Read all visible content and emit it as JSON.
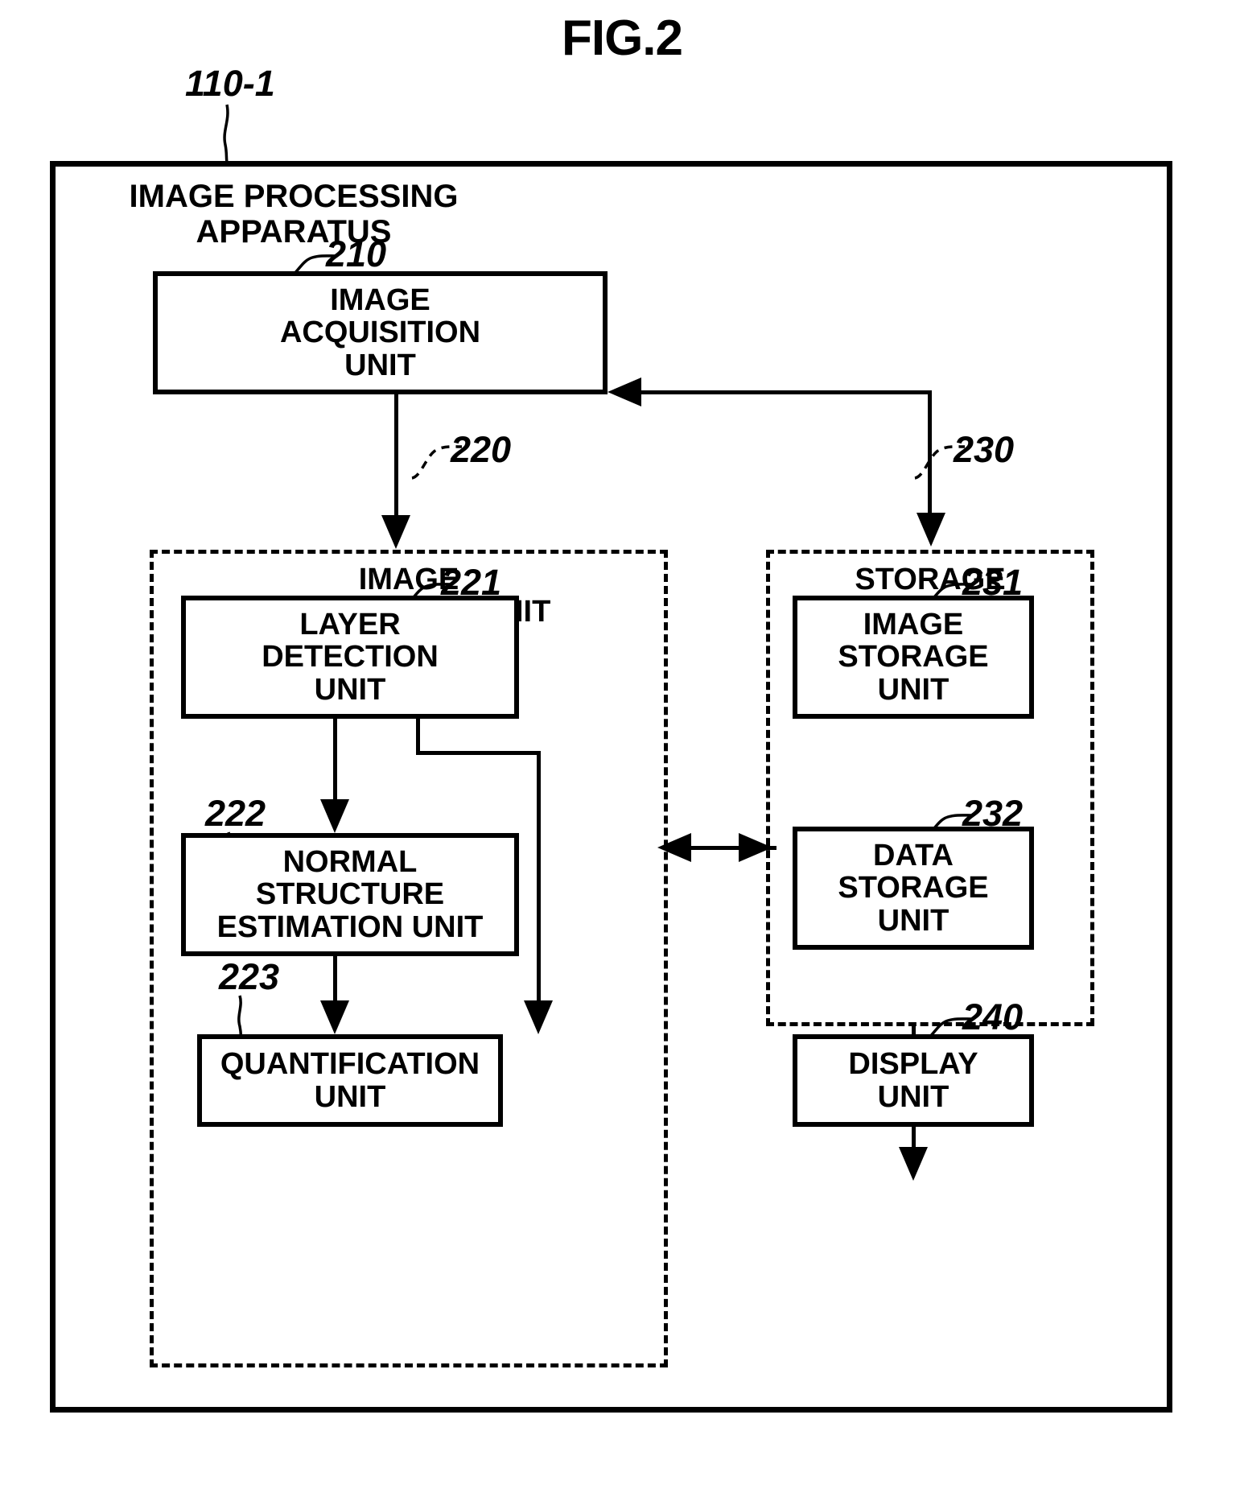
{
  "figure": {
    "title": "FIG.2",
    "apparatus_ref": "110-1",
    "apparatus_title": "IMAGE PROCESSING\nAPPARATUS"
  },
  "blocks": {
    "image_acquisition": {
      "ref": "210",
      "label": "IMAGE\nACQUISITION\nUNIT"
    },
    "image_processing": {
      "ref": "220",
      "label": "IMAGE\nPROCESSING UNIT"
    },
    "layer_detection": {
      "ref": "221",
      "label": "LAYER\nDETECTION\nUNIT"
    },
    "normal_structure": {
      "ref": "222",
      "label": "NORMAL\nSTRUCTURE\nESTIMATION UNIT"
    },
    "quantification": {
      "ref": "223",
      "label": "QUANTIFICATION\nUNIT"
    },
    "storage": {
      "ref": "230",
      "label": "STORAGE\nUNIT"
    },
    "image_storage": {
      "ref": "231",
      "label": "IMAGE\nSTORAGE\nUNIT"
    },
    "data_storage": {
      "ref": "232",
      "label": "DATA\nSTORAGE\nUNIT"
    },
    "display": {
      "ref": "240",
      "label": "DISPLAY\nUNIT"
    }
  },
  "colors": {
    "ink": "#000000",
    "paper": "#ffffff"
  }
}
